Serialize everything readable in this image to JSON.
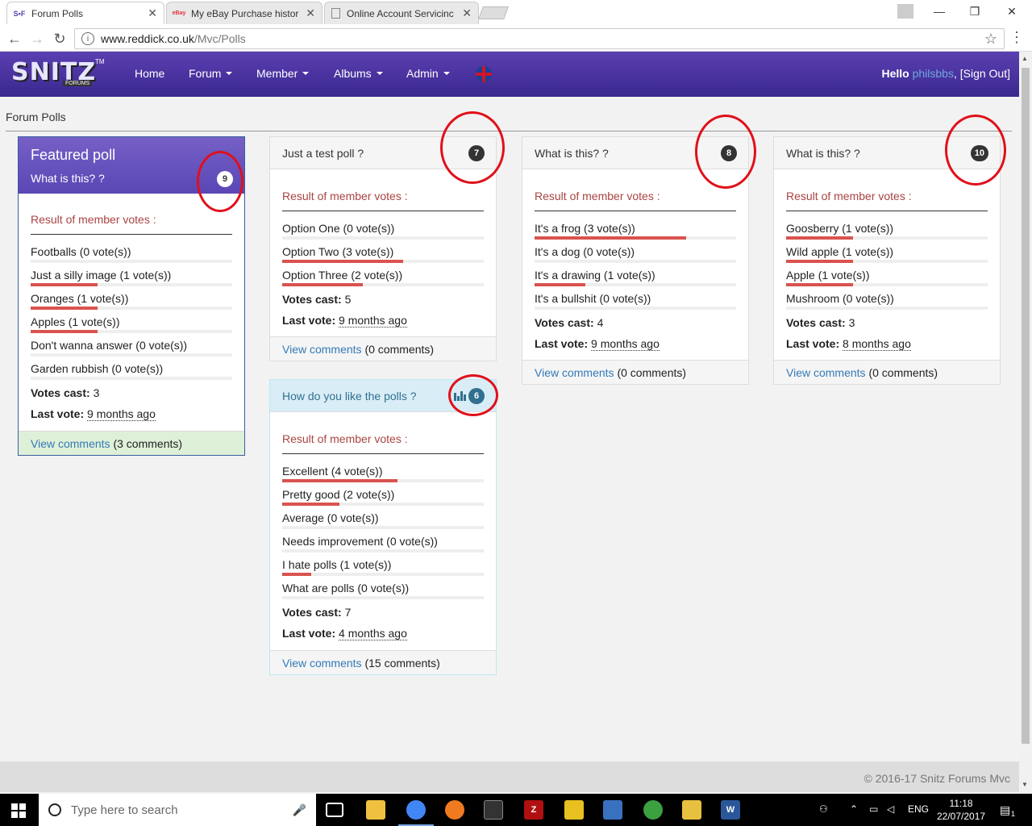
{
  "browser": {
    "tabs": [
      {
        "favicon": "S•F",
        "title": "Forum Polls",
        "active": true
      },
      {
        "favicon": "eBay",
        "title": "My eBay Purchase histor",
        "active": false
      },
      {
        "favicon": "doc",
        "title": "Online Account Servicinc",
        "active": false
      }
    ],
    "url_host": "www.reddick.co.uk",
    "url_path": "/Mvc/Polls"
  },
  "site": {
    "logo_text": "SNITZ",
    "logo_sub": "FORUMS",
    "logo_tm": "TM",
    "nav": [
      "Home",
      "Forum",
      "Member",
      "Albums",
      "Admin"
    ],
    "hello_prefix": "Hello ",
    "username": "philsbbs",
    "signout": ", [Sign Out]"
  },
  "breadcrumb": "Forum Polls",
  "labels": {
    "result_title": "Result of member votes :",
    "votes_cast": "Votes cast:",
    "last_vote": "Last vote:",
    "view_comments": "View comments"
  },
  "featured": {
    "heading": "Featured poll",
    "question": "What is this? ?",
    "badge": "9",
    "options": [
      {
        "label": "Footballs (0 vote(s))",
        "votes": 0
      },
      {
        "label": "Just a silly image  (1 vote(s))",
        "votes": 1
      },
      {
        "label": "Oranges (1 vote(s))",
        "votes": 1
      },
      {
        "label": "Apples (1 vote(s))",
        "votes": 1
      },
      {
        "label": "Don't wanna answer (0 vote(s))",
        "votes": 0
      },
      {
        "label": "Garden rubbish  (0 vote(s))",
        "votes": 0
      }
    ],
    "votes_cast": "3",
    "last_vote": " 9 months ago ",
    "comments": "(3 comments)"
  },
  "polls": [
    {
      "question": "Just a test poll ?",
      "badge": "7",
      "options": [
        {
          "label": "Option One (0 vote(s))",
          "votes": 0
        },
        {
          "label": "Option Two (3 vote(s))",
          "votes": 3
        },
        {
          "label": "Option Three (2 vote(s))",
          "votes": 2
        }
      ],
      "votes_cast": "5",
      "last_vote": " 9 months ago ",
      "comments": "(0 comments)"
    },
    {
      "question": "What is this? ?",
      "badge": "8",
      "options": [
        {
          "label": "It's a frog (3 vote(s))",
          "votes": 3
        },
        {
          "label": "It's a dog (0 vote(s))",
          "votes": 0
        },
        {
          "label": "It's a drawing (1 vote(s))",
          "votes": 1
        },
        {
          "label": "It's a bullshit (0 vote(s))",
          "votes": 0
        }
      ],
      "votes_cast": "4",
      "last_vote": " 9 months ago ",
      "comments": "(0 comments)"
    },
    {
      "question": "What is this? ?",
      "badge": "10",
      "options": [
        {
          "label": "Goosberry (1 vote(s))",
          "votes": 1
        },
        {
          "label": "Wild apple (1 vote(s))",
          "votes": 1
        },
        {
          "label": "Apple (1 vote(s))",
          "votes": 1
        },
        {
          "label": "Mushroom (0 vote(s))",
          "votes": 0
        }
      ],
      "votes_cast": "3",
      "last_vote": " 8 months ago ",
      "comments": "(0 comments)"
    },
    {
      "question": "How do you like the polls ?",
      "badge": "6",
      "options": [
        {
          "label": "Excellent (4 vote(s))",
          "votes": 4
        },
        {
          "label": "Pretty good (2 vote(s))",
          "votes": 2
        },
        {
          "label": "Average (0 vote(s))",
          "votes": 0
        },
        {
          "label": "Needs improvement (0 vote(s))",
          "votes": 0
        },
        {
          "label": "I hate polls (1 vote(s))",
          "votes": 1
        },
        {
          "label": "What are polls (0 vote(s))",
          "votes": 0
        }
      ],
      "votes_cast": "7",
      "last_vote": " 4 months ago ",
      "comments": "(15 comments)"
    }
  ],
  "footer": "© 2016-17 Snitz Forums Mvc",
  "taskbar": {
    "search_placeholder": "Type here to search",
    "lang": "ENG",
    "time": "11:18",
    "date": "22/07/2017",
    "notifications": "1"
  },
  "colors": {
    "nav_top": "#5a3fb0",
    "nav_bottom": "#3b2890",
    "bar": "#d9534f",
    "result_title": "#a94442",
    "link": "#337ab7",
    "annotation_ring": "#e0101a"
  }
}
